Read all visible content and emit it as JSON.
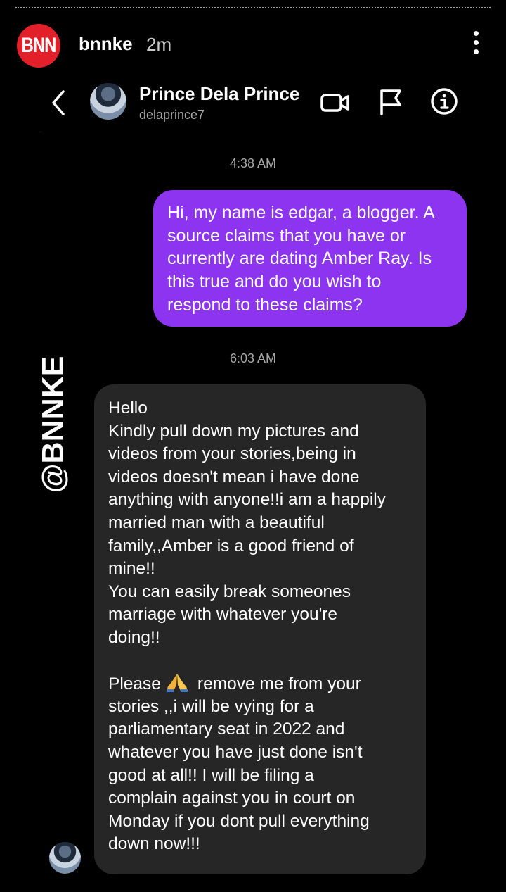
{
  "story": {
    "username": "bnnke",
    "time": "2m",
    "logo_text": "BNN"
  },
  "dm": {
    "name": "Prince Dela Prince",
    "handle": "delaprince7"
  },
  "messages": {
    "ts1": "4:38 AM",
    "outgoing": [
      "Hi, my name is edgar, a blogger. A",
      "source claims that you have or",
      "currently are dating Amber Ray. Is",
      "this true and do you wish to",
      "respond to these claims?"
    ],
    "ts2": "6:03 AM",
    "incoming": [
      "Hello",
      "Kindly pull down my pictures and",
      "videos from your stories,being in",
      "videos doesn't mean i have done",
      "anything with anyone!!i am a happily",
      "married man with a beautiful",
      "family,,Amber is a good friend of",
      "mine!!",
      "You can easily break someones",
      "marriage with whatever you're",
      "doing!!",
      "",
      "Please",
      "stories ,,i will be  vying for a",
      "parliamentary seat in 2022 and",
      "whatever you have just done isn't",
      "good at all!! I will be filing a",
      "complain against you in court on",
      "Monday if you dont pull everything",
      "down now!!!"
    ],
    "please_rest": "remove me from your",
    "emoji": "pray-icon"
  },
  "watermark": "@BNNKE",
  "colors": {
    "outgoing_bubble": "#8c34f0",
    "incoming_bubble": "#262626",
    "brand_red": "#e2202a"
  }
}
